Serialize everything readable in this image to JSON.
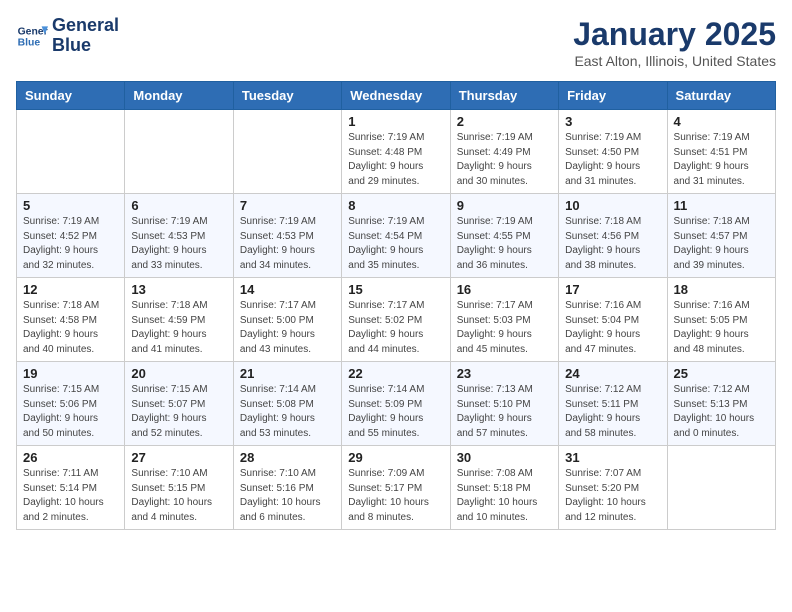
{
  "header": {
    "logo_line1": "General",
    "logo_line2": "Blue",
    "month": "January 2025",
    "location": "East Alton, Illinois, United States"
  },
  "weekdays": [
    "Sunday",
    "Monday",
    "Tuesday",
    "Wednesday",
    "Thursday",
    "Friday",
    "Saturday"
  ],
  "weeks": [
    [
      {
        "day": "",
        "info": ""
      },
      {
        "day": "",
        "info": ""
      },
      {
        "day": "",
        "info": ""
      },
      {
        "day": "1",
        "info": "Sunrise: 7:19 AM\nSunset: 4:48 PM\nDaylight: 9 hours\nand 29 minutes."
      },
      {
        "day": "2",
        "info": "Sunrise: 7:19 AM\nSunset: 4:49 PM\nDaylight: 9 hours\nand 30 minutes."
      },
      {
        "day": "3",
        "info": "Sunrise: 7:19 AM\nSunset: 4:50 PM\nDaylight: 9 hours\nand 31 minutes."
      },
      {
        "day": "4",
        "info": "Sunrise: 7:19 AM\nSunset: 4:51 PM\nDaylight: 9 hours\nand 31 minutes."
      }
    ],
    [
      {
        "day": "5",
        "info": "Sunrise: 7:19 AM\nSunset: 4:52 PM\nDaylight: 9 hours\nand 32 minutes."
      },
      {
        "day": "6",
        "info": "Sunrise: 7:19 AM\nSunset: 4:53 PM\nDaylight: 9 hours\nand 33 minutes."
      },
      {
        "day": "7",
        "info": "Sunrise: 7:19 AM\nSunset: 4:53 PM\nDaylight: 9 hours\nand 34 minutes."
      },
      {
        "day": "8",
        "info": "Sunrise: 7:19 AM\nSunset: 4:54 PM\nDaylight: 9 hours\nand 35 minutes."
      },
      {
        "day": "9",
        "info": "Sunrise: 7:19 AM\nSunset: 4:55 PM\nDaylight: 9 hours\nand 36 minutes."
      },
      {
        "day": "10",
        "info": "Sunrise: 7:18 AM\nSunset: 4:56 PM\nDaylight: 9 hours\nand 38 minutes."
      },
      {
        "day": "11",
        "info": "Sunrise: 7:18 AM\nSunset: 4:57 PM\nDaylight: 9 hours\nand 39 minutes."
      }
    ],
    [
      {
        "day": "12",
        "info": "Sunrise: 7:18 AM\nSunset: 4:58 PM\nDaylight: 9 hours\nand 40 minutes."
      },
      {
        "day": "13",
        "info": "Sunrise: 7:18 AM\nSunset: 4:59 PM\nDaylight: 9 hours\nand 41 minutes."
      },
      {
        "day": "14",
        "info": "Sunrise: 7:17 AM\nSunset: 5:00 PM\nDaylight: 9 hours\nand 43 minutes."
      },
      {
        "day": "15",
        "info": "Sunrise: 7:17 AM\nSunset: 5:02 PM\nDaylight: 9 hours\nand 44 minutes."
      },
      {
        "day": "16",
        "info": "Sunrise: 7:17 AM\nSunset: 5:03 PM\nDaylight: 9 hours\nand 45 minutes."
      },
      {
        "day": "17",
        "info": "Sunrise: 7:16 AM\nSunset: 5:04 PM\nDaylight: 9 hours\nand 47 minutes."
      },
      {
        "day": "18",
        "info": "Sunrise: 7:16 AM\nSunset: 5:05 PM\nDaylight: 9 hours\nand 48 minutes."
      }
    ],
    [
      {
        "day": "19",
        "info": "Sunrise: 7:15 AM\nSunset: 5:06 PM\nDaylight: 9 hours\nand 50 minutes."
      },
      {
        "day": "20",
        "info": "Sunrise: 7:15 AM\nSunset: 5:07 PM\nDaylight: 9 hours\nand 52 minutes."
      },
      {
        "day": "21",
        "info": "Sunrise: 7:14 AM\nSunset: 5:08 PM\nDaylight: 9 hours\nand 53 minutes."
      },
      {
        "day": "22",
        "info": "Sunrise: 7:14 AM\nSunset: 5:09 PM\nDaylight: 9 hours\nand 55 minutes."
      },
      {
        "day": "23",
        "info": "Sunrise: 7:13 AM\nSunset: 5:10 PM\nDaylight: 9 hours\nand 57 minutes."
      },
      {
        "day": "24",
        "info": "Sunrise: 7:12 AM\nSunset: 5:11 PM\nDaylight: 9 hours\nand 58 minutes."
      },
      {
        "day": "25",
        "info": "Sunrise: 7:12 AM\nSunset: 5:13 PM\nDaylight: 10 hours\nand 0 minutes."
      }
    ],
    [
      {
        "day": "26",
        "info": "Sunrise: 7:11 AM\nSunset: 5:14 PM\nDaylight: 10 hours\nand 2 minutes."
      },
      {
        "day": "27",
        "info": "Sunrise: 7:10 AM\nSunset: 5:15 PM\nDaylight: 10 hours\nand 4 minutes."
      },
      {
        "day": "28",
        "info": "Sunrise: 7:10 AM\nSunset: 5:16 PM\nDaylight: 10 hours\nand 6 minutes."
      },
      {
        "day": "29",
        "info": "Sunrise: 7:09 AM\nSunset: 5:17 PM\nDaylight: 10 hours\nand 8 minutes."
      },
      {
        "day": "30",
        "info": "Sunrise: 7:08 AM\nSunset: 5:18 PM\nDaylight: 10 hours\nand 10 minutes."
      },
      {
        "day": "31",
        "info": "Sunrise: 7:07 AM\nSunset: 5:20 PM\nDaylight: 10 hours\nand 12 minutes."
      },
      {
        "day": "",
        "info": ""
      }
    ]
  ]
}
